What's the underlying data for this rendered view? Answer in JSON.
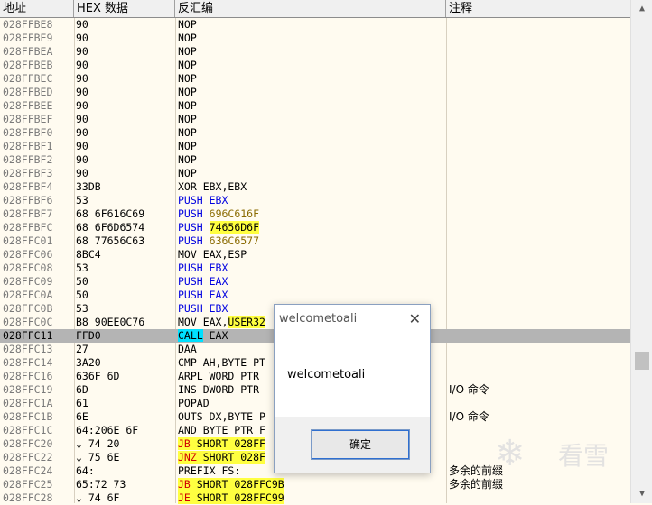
{
  "header": {
    "address": "地址",
    "hex": "HEX 数据",
    "disasm": "反汇编",
    "comment": "注释"
  },
  "rows": [
    {
      "addr": "028FFBE8",
      "hex": "90",
      "dis": [
        {
          "t": "NOP"
        }
      ]
    },
    {
      "addr": "028FFBE9",
      "hex": "90",
      "dis": [
        {
          "t": "NOP"
        }
      ]
    },
    {
      "addr": "028FFBEA",
      "hex": "90",
      "dis": [
        {
          "t": "NOP"
        }
      ]
    },
    {
      "addr": "028FFBEB",
      "hex": "90",
      "dis": [
        {
          "t": "NOP"
        }
      ]
    },
    {
      "addr": "028FFBEC",
      "hex": "90",
      "dis": [
        {
          "t": "NOP"
        }
      ]
    },
    {
      "addr": "028FFBED",
      "hex": "90",
      "dis": [
        {
          "t": "NOP"
        }
      ]
    },
    {
      "addr": "028FFBEE",
      "hex": "90",
      "dis": [
        {
          "t": "NOP"
        }
      ]
    },
    {
      "addr": "028FFBEF",
      "hex": "90",
      "dis": [
        {
          "t": "NOP"
        }
      ]
    },
    {
      "addr": "028FFBF0",
      "hex": "90",
      "dis": [
        {
          "t": "NOP"
        }
      ]
    },
    {
      "addr": "028FFBF1",
      "hex": "90",
      "dis": [
        {
          "t": "NOP"
        }
      ]
    },
    {
      "addr": "028FFBF2",
      "hex": "90",
      "dis": [
        {
          "t": "NOP"
        }
      ]
    },
    {
      "addr": "028FFBF3",
      "hex": "90",
      "dis": [
        {
          "t": "NOP"
        }
      ]
    },
    {
      "addr": "028FFBF4",
      "hex": "33DB",
      "dis": [
        {
          "t": "XOR EBX,EBX"
        }
      ]
    },
    {
      "addr": "028FFBF6",
      "hex": "53",
      "dis": [
        {
          "t": "PUSH",
          "c": "op-push"
        },
        {
          "t": " EBX",
          "c": "op-push"
        }
      ]
    },
    {
      "addr": "028FFBF7",
      "hex": "68 6F616C69",
      "dis": [
        {
          "t": "PUSH",
          "c": "op-push"
        },
        {
          "t": " "
        },
        {
          "t": "696C616F",
          "c": "arg-push"
        }
      ]
    },
    {
      "addr": "028FFBFC",
      "hex": "68 6F6D6574",
      "dis": [
        {
          "t": "PUSH",
          "c": "op-push"
        },
        {
          "t": " "
        },
        {
          "t": "74656D6F",
          "c": "hl"
        }
      ]
    },
    {
      "addr": "028FFC01",
      "hex": "68 77656C63",
      "dis": [
        {
          "t": "PUSH",
          "c": "op-push"
        },
        {
          "t": " "
        },
        {
          "t": "636C6577",
          "c": "arg-push"
        }
      ]
    },
    {
      "addr": "028FFC06",
      "hex": "8BC4",
      "dis": [
        {
          "t": "MOV EAX,ESP"
        }
      ]
    },
    {
      "addr": "028FFC08",
      "hex": "53",
      "dis": [
        {
          "t": "PUSH",
          "c": "op-push"
        },
        {
          "t": " EBX",
          "c": "op-push"
        }
      ]
    },
    {
      "addr": "028FFC09",
      "hex": "50",
      "dis": [
        {
          "t": "PUSH",
          "c": "op-push"
        },
        {
          "t": " EAX",
          "c": "op-push"
        }
      ]
    },
    {
      "addr": "028FFC0A",
      "hex": "50",
      "dis": [
        {
          "t": "PUSH",
          "c": "op-push"
        },
        {
          "t": " EAX",
          "c": "op-push"
        }
      ]
    },
    {
      "addr": "028FFC0B",
      "hex": "53",
      "dis": [
        {
          "t": "PUSH",
          "c": "op-push"
        },
        {
          "t": " EBX",
          "c": "op-push"
        }
      ]
    },
    {
      "addr": "028FFC0C",
      "hex": "B8 90EE0C76",
      "dis": [
        {
          "t": "MOV EAX,"
        },
        {
          "t": "USER32",
          "c": "hl"
        }
      ]
    },
    {
      "addr": "028FFC11",
      "hex": "FFD0",
      "dis": [
        {
          "t": "CALL",
          "c": "op-call"
        },
        {
          "t": " EAX"
        }
      ],
      "selected": true
    },
    {
      "addr": "028FFC13",
      "hex": "27",
      "dis": [
        {
          "t": "DAA"
        }
      ]
    },
    {
      "addr": "028FFC14",
      "hex": "3A20",
      "dis": [
        {
          "t": "CMP AH,BYTE PT"
        }
      ]
    },
    {
      "addr": "028FFC16",
      "hex": "636F 6D",
      "dis": [
        {
          "t": "ARPL WORD PTR"
        }
      ]
    },
    {
      "addr": "028FFC19",
      "hex": "6D",
      "dis": [
        {
          "t": "INS DWORD PTR"
        }
      ],
      "cmt": "I/O 命令"
    },
    {
      "addr": "028FFC1A",
      "hex": "61",
      "dis": [
        {
          "t": "POPAD"
        }
      ]
    },
    {
      "addr": "028FFC1B",
      "hex": "6E",
      "dis": [
        {
          "t": "OUTS DX,BYTE P"
        }
      ],
      "cmt": "I/O 命令"
    },
    {
      "addr": "028FFC1C",
      "hex": "64:206E 6F",
      "dis": [
        {
          "t": "AND BYTE PTR F"
        }
      ]
    },
    {
      "addr": "028FFC20",
      "hex": "⌄ 74 20",
      "dis": [
        {
          "t": "JB",
          "c": "op-j"
        },
        {
          "t": " SHORT 028FF",
          "c": "hl"
        }
      ]
    },
    {
      "addr": "028FFC22",
      "hex": "⌄ 75 6E",
      "dis": [
        {
          "t": "JNZ",
          "c": "op-j"
        },
        {
          "t": " SHORT 028F",
          "c": "hl"
        }
      ]
    },
    {
      "addr": "028FFC24",
      "hex": "64:",
      "dis": [
        {
          "t": "PREFIX FS:"
        }
      ],
      "cmt": "多余的前缀"
    },
    {
      "addr": "028FFC25",
      "hex": "65:72 73",
      "dis": [
        {
          "t": "JB",
          "c": "op-j"
        },
        {
          "t": " SHORT 028FFC9B",
          "c": "hl"
        }
      ],
      "cmt": "多余的前缀"
    },
    {
      "addr": "028FFC28",
      "hex": "⌄ 74 6F",
      "dis": [
        {
          "t": "JE",
          "c": "op-j"
        },
        {
          "t": " SHORT 028FFC99",
          "c": "hl"
        }
      ]
    }
  ],
  "dialog": {
    "title": "welcometoali",
    "message": "welcometoali",
    "ok_label": "确定",
    "close_glyph": "✕"
  },
  "watermark": {
    "text": "看雪",
    "flake": "❄"
  }
}
